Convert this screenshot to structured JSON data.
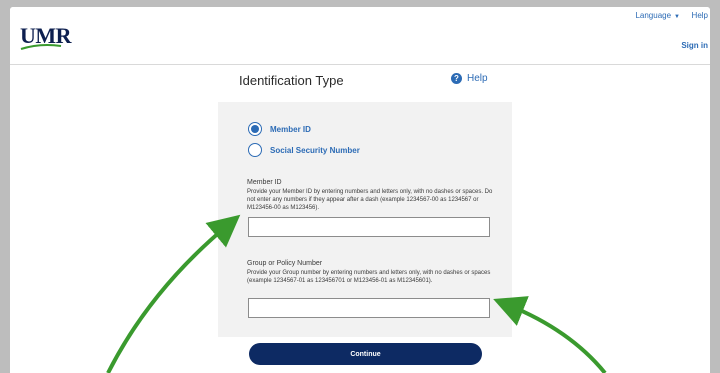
{
  "header": {
    "logo_text": "UMR",
    "language_label": "Language",
    "help_label": "Help",
    "signin_label": "Sign in"
  },
  "main": {
    "title": "Identification Type",
    "help_label": "Help"
  },
  "form": {
    "id_options": [
      {
        "label": "Member ID",
        "checked": true
      },
      {
        "label": "Social Security Number",
        "checked": false
      }
    ],
    "member_id": {
      "title": "Member ID",
      "description": "Provide your Member ID by entering numbers and letters only, with no dashes or spaces. Do not enter any numbers if they appear after a dash (example 1234567-00 as 1234567 or M123456-00 as M123456).",
      "value": ""
    },
    "group_number": {
      "title": "Group or Policy Number",
      "description": "Provide your Group number by entering numbers and letters only, with no dashes or spaces (example 1234567-01 as 123456701 or M123456-01 as M12345601).",
      "value": ""
    },
    "continue_label": "Continue"
  },
  "colors": {
    "brand_navy": "#0d2a63",
    "link_blue": "#2c6bb5",
    "panel_gray": "#f2f2f2",
    "annotation_green": "#3a9a2e"
  }
}
